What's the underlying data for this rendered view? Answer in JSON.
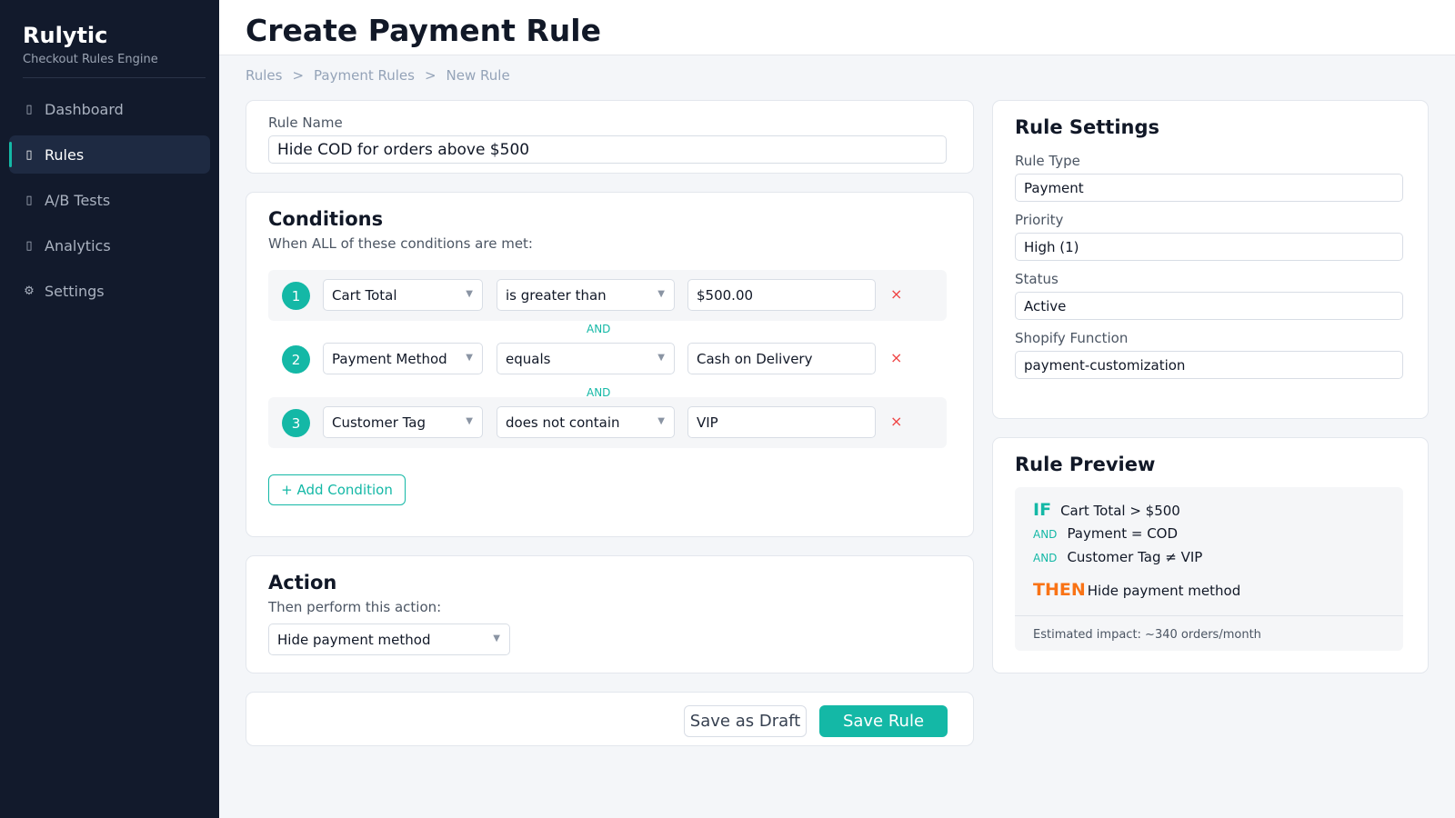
{
  "sidebar": {
    "brand": "Rulytic",
    "subtitle": "Checkout Rules Engine",
    "items": [
      {
        "label": "Dashboard",
        "icon": "dashboard-icon",
        "glyph": "▯"
      },
      {
        "label": "Rules",
        "icon": "rules-icon",
        "glyph": "▯",
        "active": true
      },
      {
        "label": "A/B Tests",
        "icon": "ab-tests-icon",
        "glyph": "▯"
      },
      {
        "label": "Analytics",
        "icon": "analytics-icon",
        "glyph": "▯"
      },
      {
        "label": "Settings",
        "icon": "gear-icon",
        "glyph": "⚙"
      }
    ]
  },
  "header": {
    "title": "Create Payment Rule",
    "breadcrumb": [
      "Rules",
      "Payment Rules",
      "New Rule"
    ],
    "separator": ">"
  },
  "rule_name": {
    "label": "Rule Name",
    "value": "Hide COD for orders above $500"
  },
  "conditions": {
    "title": "Conditions",
    "subtitle": "When ALL of these conditions are met:",
    "joiner": "AND",
    "rows": [
      {
        "num": "1",
        "field": "Cart Total",
        "operator": "is greater than",
        "value": "$500.00"
      },
      {
        "num": "2",
        "field": "Payment Method",
        "operator": "equals",
        "value": "Cash on Delivery"
      },
      {
        "num": "3",
        "field": "Customer Tag",
        "operator": "does not contain",
        "value": "VIP"
      }
    ],
    "remove_glyph": "×",
    "add_label": "+ Add Condition"
  },
  "action": {
    "title": "Action",
    "subtitle": "Then perform this action:",
    "value": "Hide payment method"
  },
  "footer": {
    "draft_label": "Save as Draft",
    "save_label": "Save Rule"
  },
  "settings": {
    "title": "Rule Settings",
    "fields": [
      {
        "label": "Rule Type",
        "value": "Payment"
      },
      {
        "label": "Priority",
        "value": "High (1)"
      },
      {
        "label": "Status",
        "value": "Active"
      },
      {
        "label": "Shopify Function",
        "value": "payment-customization"
      }
    ]
  },
  "preview": {
    "title": "Rule Preview",
    "if_label": "IF",
    "and_label": "AND",
    "then_label": "THEN",
    "lines": [
      "Cart Total > $500",
      "Payment = COD",
      "Customer Tag ≠ VIP"
    ],
    "then_text": "Hide payment method",
    "impact": "Estimated impact: ~340 orders/month"
  },
  "colors": {
    "sidebar_bg": "#121a2c",
    "accent": "#14b8a6",
    "then": "#f97316",
    "remove": "#ef4444"
  }
}
